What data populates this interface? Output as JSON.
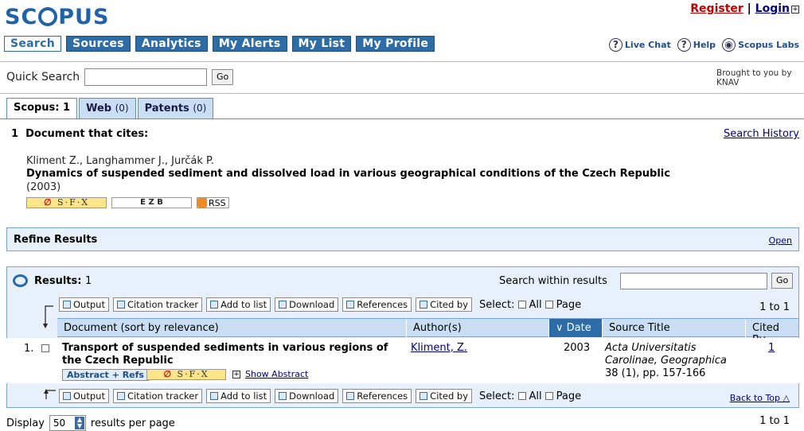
{
  "header": {
    "logo_text": "SCOPUS",
    "register": "Register",
    "separator": "|",
    "login": "Login"
  },
  "nav": {
    "tabs": [
      "Search",
      "Sources",
      "Analytics",
      "My Alerts",
      "My List",
      "My Profile"
    ]
  },
  "help_links": {
    "live_chat": "Live Chat",
    "help": "Help",
    "labs": "Scopus Labs"
  },
  "quick_search": {
    "label": "Quick Search",
    "value": "",
    "go": "Go",
    "brought": "Brought to you by KNAV"
  },
  "content_tabs": {
    "scopus": "Scopus: 1",
    "web": "Web",
    "web_count": "(0)",
    "patents": "Patents",
    "patents_count": "(0)"
  },
  "cites": {
    "heading": "1  Document that cites:",
    "search_history": "Search History",
    "authors": "Kliment Z., Langhammer J., Jurčák P.",
    "title": "Dynamics of suspended sediment and dissolved load in various geographical conditions of the Czech Republic",
    "year": "(2003)",
    "sfx": "S·F·X",
    "ezb": "E Z B",
    "rss": "RSS"
  },
  "refine": {
    "title": "Refine Results",
    "open": "Open"
  },
  "results": {
    "label": "Results:",
    "count": "1",
    "search_within": "Search within results",
    "go": "Go",
    "range": "1 to 1",
    "toolbar": {
      "output": "Output",
      "citation_tracker": "Citation tracker",
      "add_to_list": "Add to list",
      "download": "Download",
      "references": "References",
      "cited_by": "Cited by",
      "select": "Select:",
      "all": "All",
      "page": "Page"
    },
    "columns": {
      "document": "Document (sort by relevance)",
      "authors": "Author(s)",
      "date": "Date",
      "source": "Source Title",
      "cited_by": "Cited By"
    },
    "rows": [
      {
        "num": "1.",
        "title": "Transport of suspended sediments in various regions of the Czech Republic",
        "author": "Kliment, Z.",
        "year": "2003",
        "source_italic": "Acta Universitatis Carolinae, Geographica",
        "source_detail": "38 (1), pp. 157-166",
        "cited": "1",
        "abstract_refs": "Abstract + Refs",
        "show_abstract": "Show Abstract"
      }
    ],
    "back_to_top": "Back to Top"
  },
  "footer": {
    "display": "Display",
    "per_page_value": "50",
    "per_page_label": "results per page",
    "range": "1 to 1"
  }
}
